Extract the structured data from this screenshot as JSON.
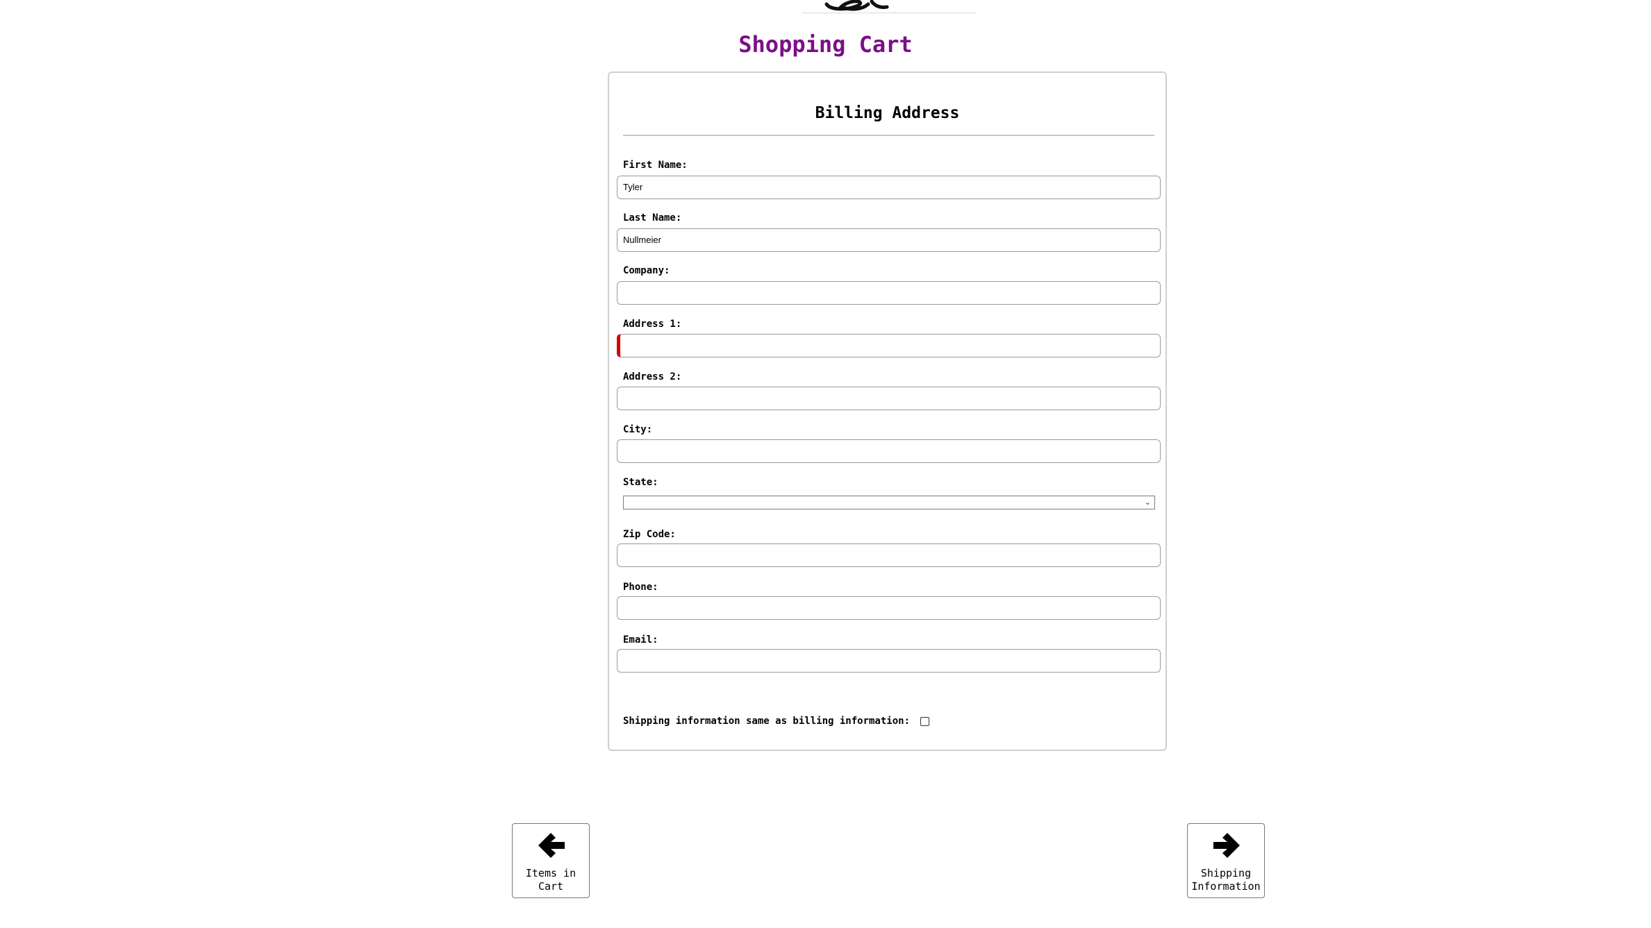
{
  "header": {
    "title": "Shopping Cart"
  },
  "billing": {
    "title": "Billing Address",
    "fields": {
      "first_name": {
        "label": "First Name:",
        "value": "Tyler"
      },
      "last_name": {
        "label": "Last Name:",
        "value": "Nullmeier"
      },
      "company": {
        "label": "Company:",
        "value": ""
      },
      "address1": {
        "label": "Address 1:",
        "value": ""
      },
      "address2": {
        "label": "Address 2:",
        "value": ""
      },
      "city": {
        "label": "City:",
        "value": ""
      },
      "state": {
        "label": "State:",
        "value": ""
      },
      "zip": {
        "label": "Zip Code:",
        "value": ""
      },
      "phone": {
        "label": "Phone:",
        "value": ""
      },
      "email": {
        "label": "Email:",
        "value": ""
      }
    },
    "same_as_shipping": {
      "label": "Shipping information same as billing information:",
      "checked": false
    }
  },
  "navigation": {
    "prev": {
      "label": "Items in Cart",
      "icon": "arrow-left-icon"
    },
    "next": {
      "label": "Shipping Information",
      "icon": "arrow-right-icon"
    }
  },
  "colors": {
    "title": "#7b0f86",
    "invalid_marker": "#d40000"
  }
}
